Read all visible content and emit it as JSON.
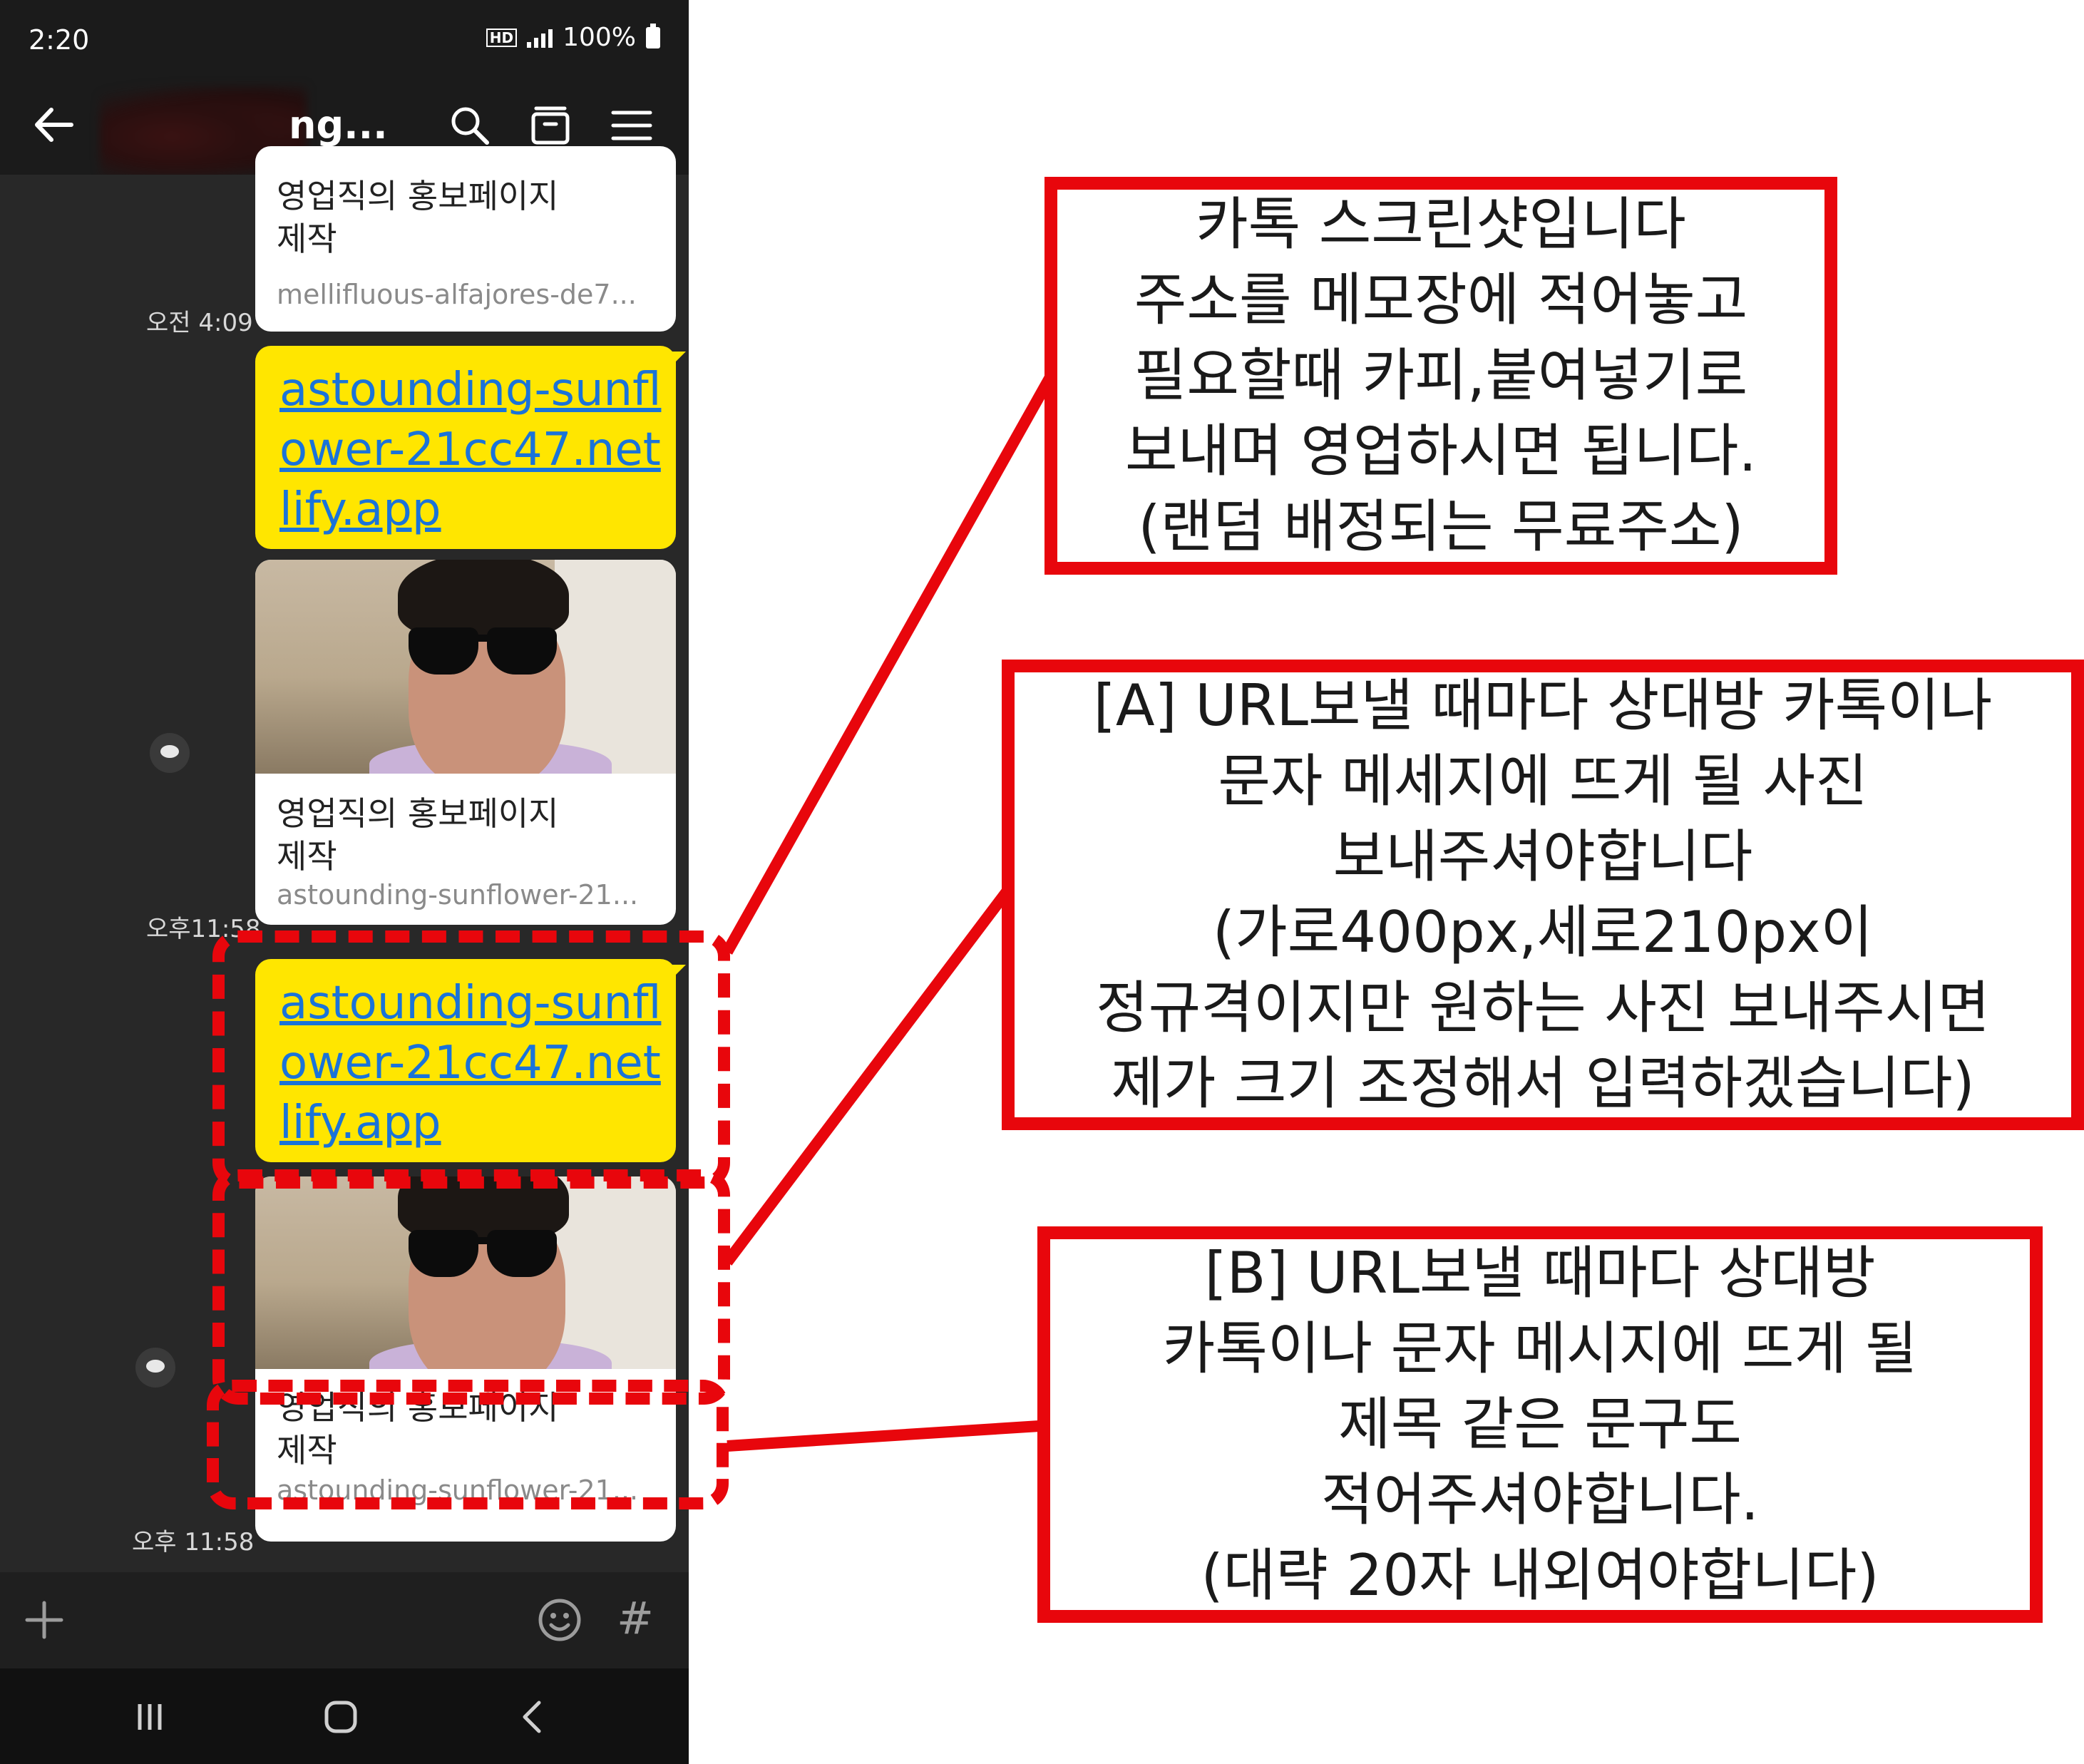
{
  "status_bar": {
    "time": "2:20",
    "hd_label": "HD",
    "battery_text": "100%"
  },
  "header": {
    "title": "ng..."
  },
  "messages": [
    {
      "type": "card",
      "title": "영업직의 홍보페이지\n제작",
      "url": "mellifluous-alfajores-de7...",
      "time": "오전 4:09"
    },
    {
      "type": "link",
      "text": "astounding-sunflower-21cc47.netlify.app"
    },
    {
      "type": "card_image",
      "title": "영업직의 홍보페이지\n제작",
      "url": "astounding-sunflower-21...",
      "time": "오후11:58"
    },
    {
      "type": "link",
      "text": "astounding-sunflower-21cc47.netlify.app"
    },
    {
      "type": "card_image",
      "title": "영업직의 홍보페이지\n제작",
      "url": "astounding-sunflower-21...",
      "time": "오후 11:58"
    }
  ],
  "input_bar": {
    "hash_label": "#"
  },
  "annotations": {
    "note1": "카톡 스크린샷입니다\n주소를 메모장에 적어놓고\n필요할때 카피,붙여넣기로\n보내며 영업하시면 됩니다.\n(랜덤 배정되는 무료주소)",
    "note2": "[A] URL보낼 때마다 상대방 카톡이나\n문자 메세지에 뜨게 될 사진\n보내주셔야합니다\n(가로400px,세로210px이\n정규격이지만 원하는 사진 보내주시면\n제가 크기 조정해서 입력하겠습니다)",
    "note3": "[B] URL보낼 때마다 상대방\n카톡이나 문자 메시지에 뜨게 될\n제목 같은 문구도\n적어주셔야합니다.\n(대략 20자 내외여야합니다)"
  },
  "colors": {
    "accent_red": "#e8060c",
    "kakao_yellow": "#ffe600",
    "link_blue": "#1a73d9",
    "chat_bg": "#282828"
  }
}
